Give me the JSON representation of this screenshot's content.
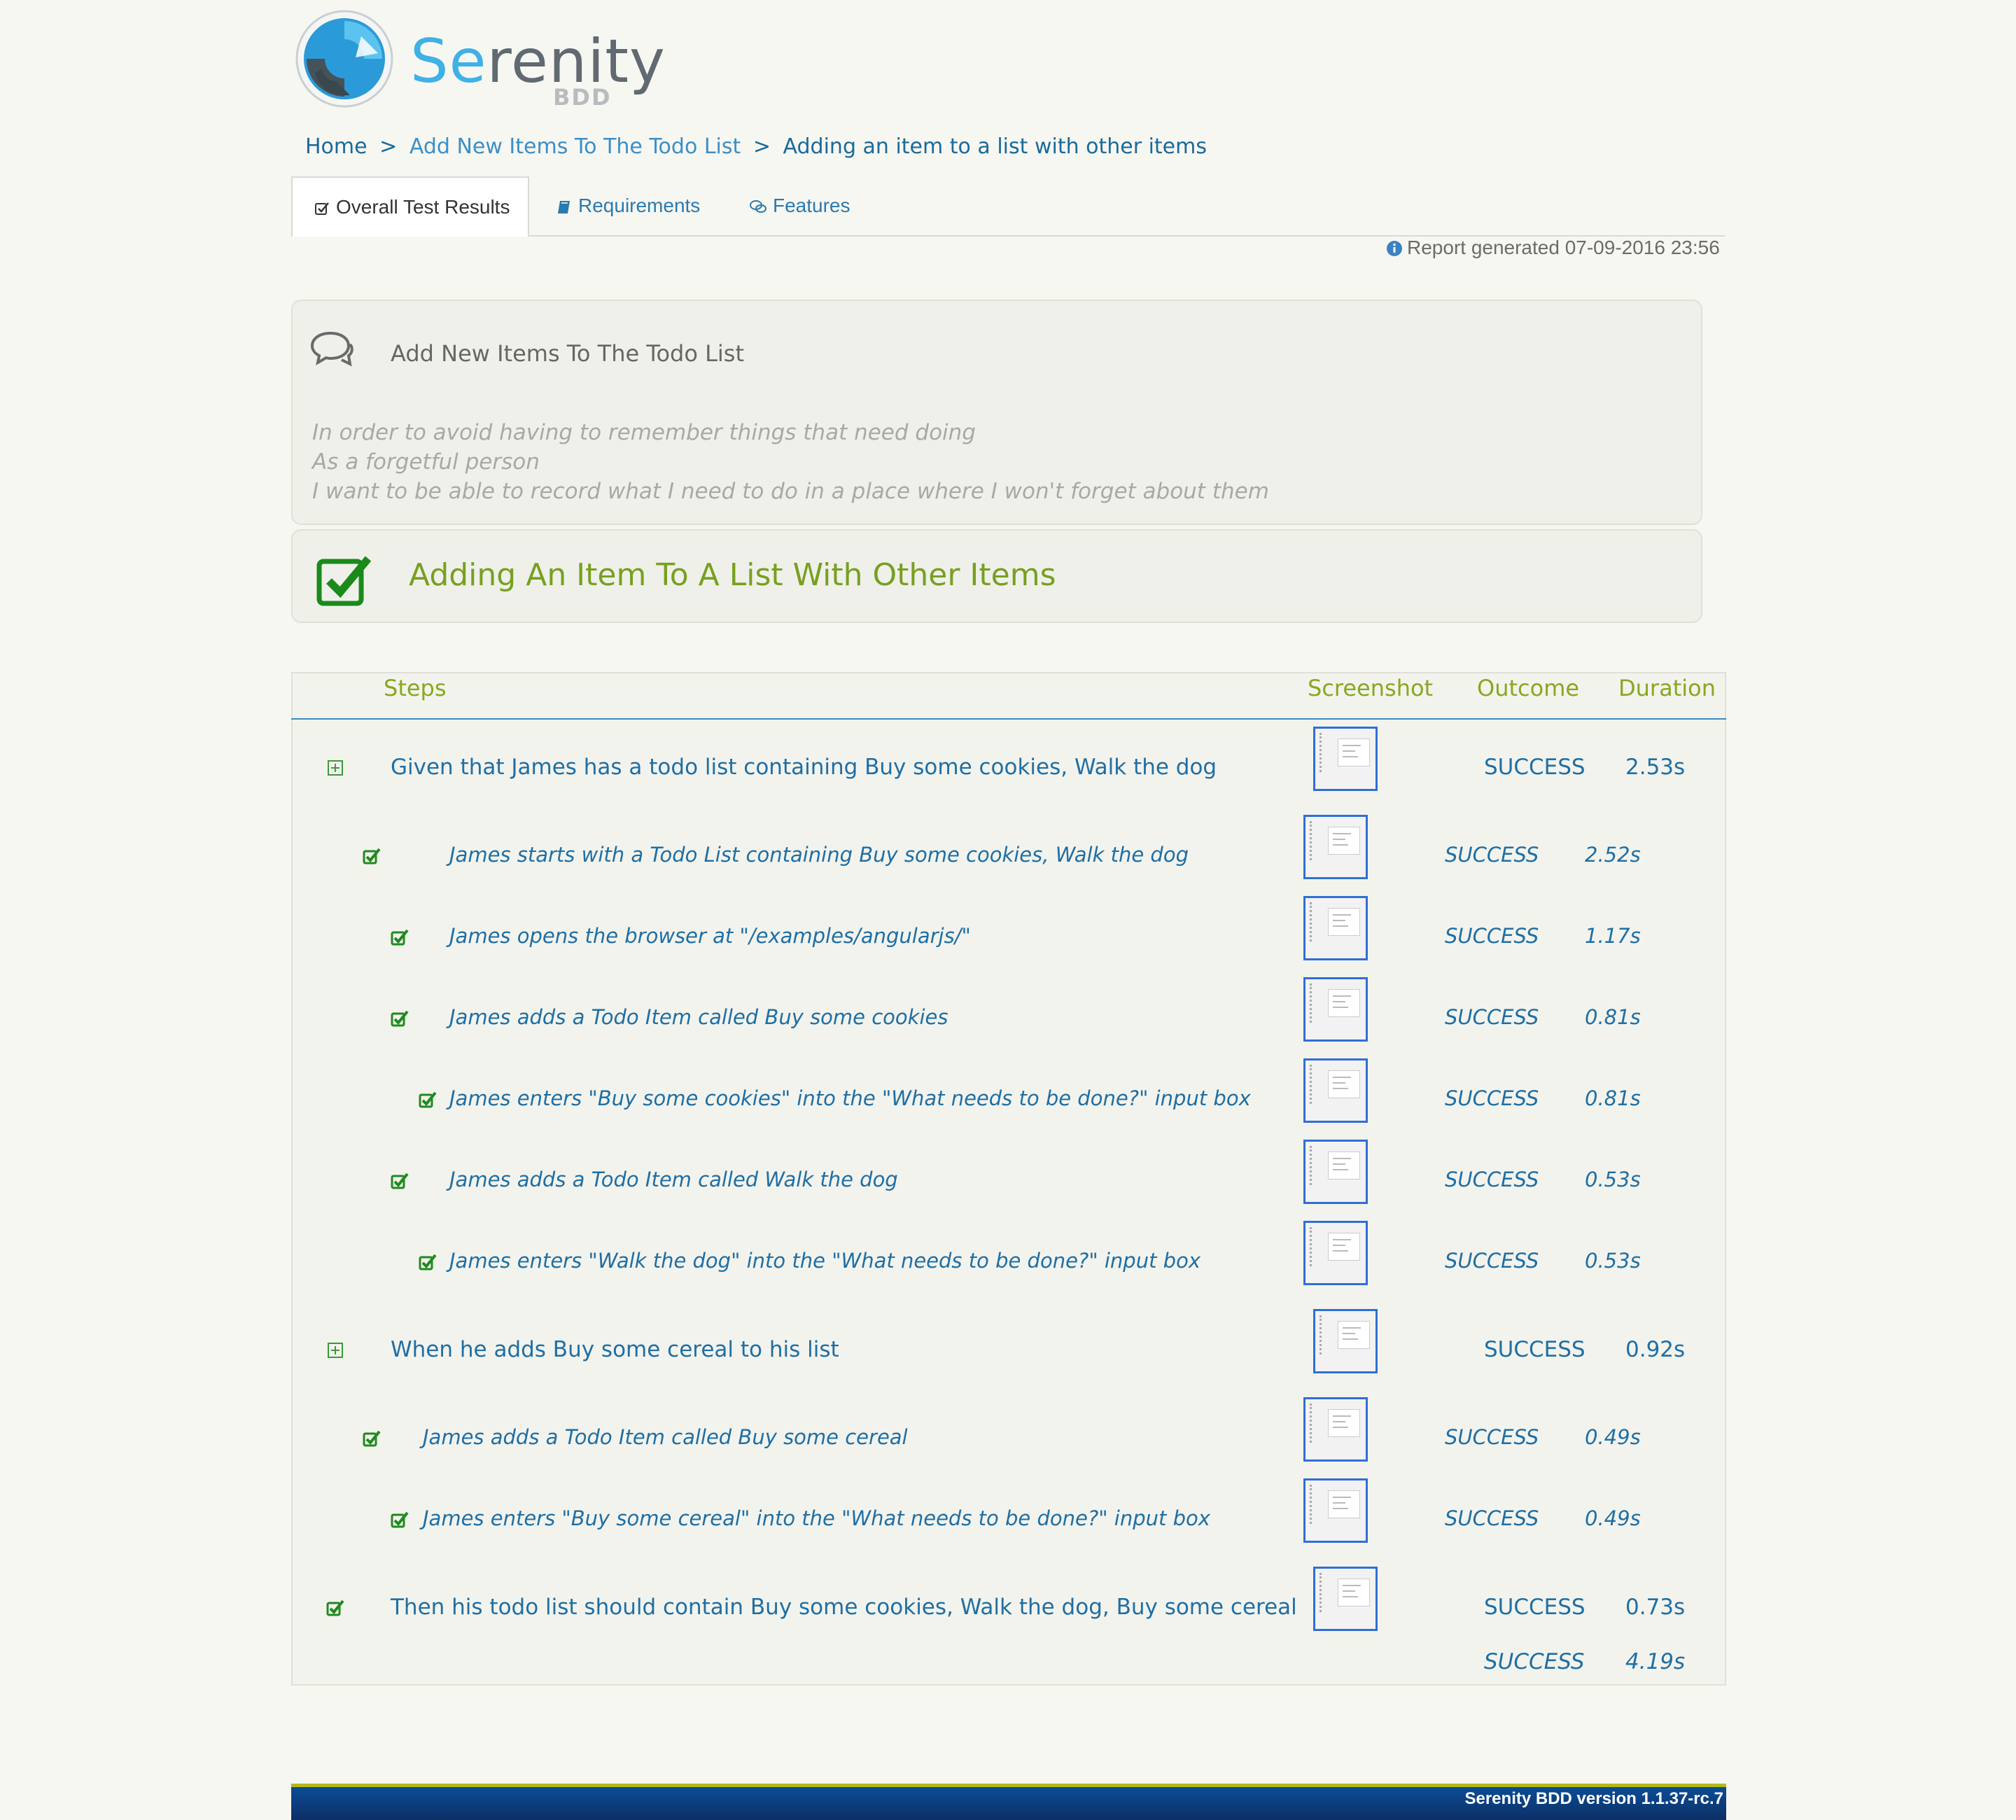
{
  "logo": {
    "brand_first": "Se",
    "brand_rest": "renity",
    "sub": "BDD"
  },
  "breadcrumb": {
    "home": "Home",
    "sep": ">",
    "feature": "Add New Items To The Todo List",
    "current": "Adding an item to a list with other items"
  },
  "tabs": {
    "overall": "Overall Test Results",
    "requirements": "Requirements",
    "features": "Features"
  },
  "report_generated": "Report generated 07-09-2016 23:56",
  "feature": {
    "title": "Add New Items To The Todo List",
    "narrative": [
      "In order to avoid having to remember things that need doing",
      "As a forgetful person",
      "I want to be able to record what I need to do in a place where I won't forget about them"
    ]
  },
  "scenario": {
    "title": "Adding An Item To A List With Other Items"
  },
  "steps_table": {
    "headers": {
      "steps": "Steps",
      "screenshot": "Screenshot",
      "outcome": "Outcome",
      "duration": "Duration"
    },
    "rows": [
      {
        "text": "Given that James has a todo list containing Buy some cookies, Walk the dog",
        "outcome": "SUCCESS",
        "duration": "2.53s",
        "level": 0,
        "icon": "expand-icon"
      },
      {
        "text": "James starts with a Todo List containing Buy some cookies, Walk the dog",
        "outcome": "SUCCESS",
        "duration": "2.52s",
        "level": 1,
        "icon": "check-icon"
      },
      {
        "text": "James opens the browser at \"/examples/angularjs/\"",
        "outcome": "SUCCESS",
        "duration": "1.17s",
        "level": 2,
        "icon": "check-icon"
      },
      {
        "text": "James adds a Todo Item called Buy some cookies",
        "outcome": "SUCCESS",
        "duration": "0.81s",
        "level": 2,
        "icon": "check-icon"
      },
      {
        "text": "James enters \"Buy some cookies\" into the \"What needs to be done?\" input box",
        "outcome": "SUCCESS",
        "duration": "0.81s",
        "level": 3,
        "icon": "check-icon"
      },
      {
        "text": "James adds a Todo Item called Walk the dog",
        "outcome": "SUCCESS",
        "duration": "0.53s",
        "level": 2,
        "icon": "check-icon"
      },
      {
        "text": "James enters \"Walk the dog\" into the \"What needs to be done?\" input box",
        "outcome": "SUCCESS",
        "duration": "0.53s",
        "level": 3,
        "icon": "check-icon"
      },
      {
        "text": "When he adds Buy some cereal to his list",
        "outcome": "SUCCESS",
        "duration": "0.92s",
        "level": 0,
        "icon": "expand-icon"
      },
      {
        "text": "James adds a Todo Item called Buy some cereal",
        "outcome": "SUCCESS",
        "duration": "0.49s",
        "level": 1,
        "icon": "check-icon"
      },
      {
        "text": "James enters \"Buy some cereal\" into the \"What needs to be done?\" input box",
        "outcome": "SUCCESS",
        "duration": "0.49s",
        "level": 2,
        "icon": "check-icon"
      },
      {
        "text": "Then his todo list should contain Buy some cookies, Walk the dog, Buy some cereal",
        "outcome": "SUCCESS",
        "duration": "0.73s",
        "level": 0,
        "icon": "check-icon"
      }
    ],
    "total": {
      "outcome": "SUCCESS",
      "duration": "4.19s"
    }
  },
  "footer": {
    "version": "Serenity BDD version 1.1.37-rc.7"
  },
  "colors": {
    "accent": "#2277aa",
    "success_green": "#77a020",
    "footer_blue": "#0a4d96"
  }
}
